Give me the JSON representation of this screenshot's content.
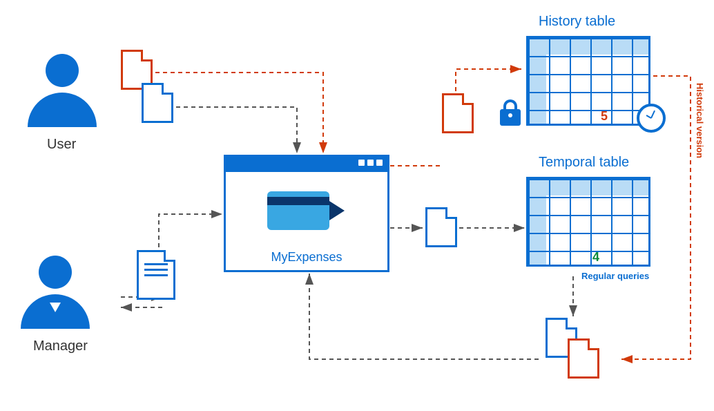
{
  "actors": {
    "user": {
      "label": "User"
    },
    "manager": {
      "label": "Manager"
    }
  },
  "app": {
    "caption": "MyExpenses"
  },
  "tables": {
    "history": {
      "title": "History table",
      "marker": "5",
      "side_label": "Historical version"
    },
    "temporal": {
      "title": "Temporal table",
      "marker": "4",
      "footer_label": "Regular queries"
    }
  },
  "colors": {
    "blue": "#0a6ed1",
    "orange": "#d13a0a",
    "green": "#0a8a3a"
  },
  "diagram_description": "Architecture diagram: A User submits expense documents (orange and blue) into the MyExpenses application window. A Manager exchanges a document with MyExpenses. MyExpenses writes the modified (orange) record to a locked History table (showing historical version '5' with a clock), and writes the current (blue) record to a Temporal table (showing current version '4'). Regular queries read from the Temporal table; historical-version queries (orange dashed path) read from the History table. Results flow back (stacked documents) to the Manager via MyExpenses.",
  "connectors": [
    {
      "from": "user-doc-orange",
      "to": "app",
      "style": "orange-dashed"
    },
    {
      "from": "user-doc-blue",
      "to": "app",
      "style": "gray-dashed"
    },
    {
      "from": "manager",
      "to": "manager-doc",
      "style": "gray-dashed-bidir"
    },
    {
      "from": "manager-doc",
      "to": "app",
      "style": "gray-dashed"
    },
    {
      "from": "app",
      "to": "history-table",
      "via": "orange-doc",
      "style": "orange-dashed"
    },
    {
      "from": "app",
      "to": "temporal-table",
      "via": "blue-doc",
      "style": "gray-dashed"
    },
    {
      "from": "temporal-table",
      "to": "result-docs",
      "label": "Regular queries",
      "style": "gray-dashed"
    },
    {
      "from": "history-table",
      "to": "result-docs",
      "label": "Historical version",
      "style": "orange-dashed"
    },
    {
      "from": "result-docs",
      "to": "app",
      "style": "gray-dashed"
    }
  ]
}
